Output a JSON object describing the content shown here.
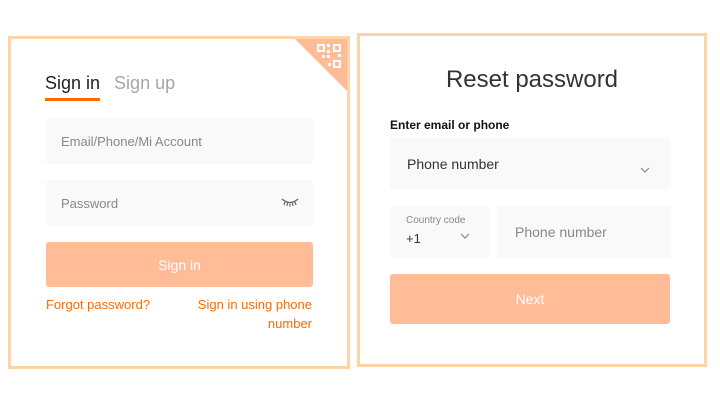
{
  "signin": {
    "tabs": [
      {
        "label": "Sign in",
        "active": true
      },
      {
        "label": "Sign up",
        "active": false
      }
    ],
    "account_placeholder": "Email/Phone/Mi Account",
    "password_placeholder": "Password",
    "password_toggle_icon": "eye-closed-icon",
    "submit_label": "Sign in",
    "forgot_link": "Forgot password?",
    "phone_signin_link": "Sign in using phone number",
    "corner_icon": "qr-code-icon"
  },
  "reset": {
    "title": "Reset password",
    "method_label": "Enter email or phone",
    "method_selected": "Phone number",
    "country_code_label": "Country code",
    "country_code_value": "+1",
    "phone_placeholder": "Phone number",
    "next_label": "Next"
  },
  "colors": {
    "accent": "#ff6900",
    "button_disabled": "#ffbc97",
    "card_border": "#ffd3a8",
    "field_bg": "#f9f9f9"
  }
}
